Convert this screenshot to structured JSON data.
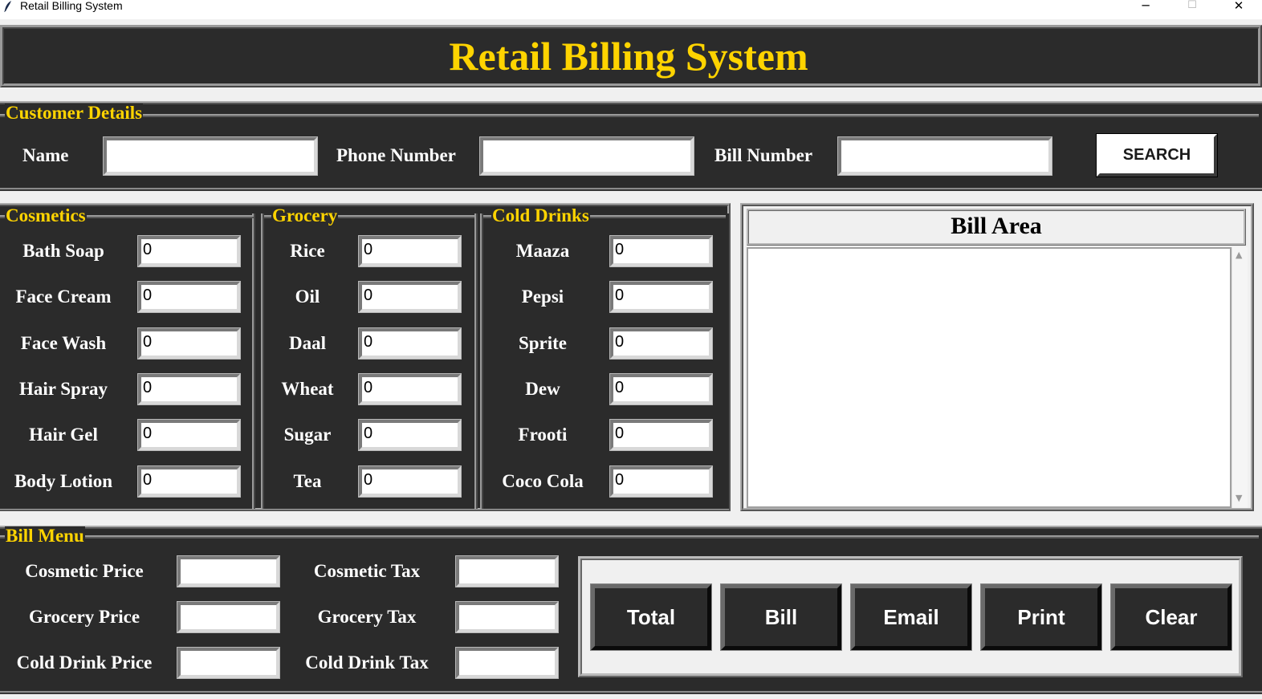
{
  "window": {
    "title": "Retail Billing System",
    "minimize_glyph": "─",
    "maximize_glyph": "☐",
    "close_glyph": "✕"
  },
  "header": {
    "title": "Retail Billing System"
  },
  "customer": {
    "legend": "Customer Details",
    "name_label": "Name",
    "name_value": "",
    "phone_label": "Phone Number",
    "phone_value": "",
    "bill_number_label": "Bill Number",
    "bill_number_value": "",
    "search_button": "SEARCH"
  },
  "cosmetics": {
    "legend": "Cosmetics",
    "items": [
      {
        "label": "Bath Soap",
        "value": "0"
      },
      {
        "label": "Face Cream",
        "value": "0"
      },
      {
        "label": "Face Wash",
        "value": "0"
      },
      {
        "label": "Hair Spray",
        "value": "0"
      },
      {
        "label": "Hair Gel",
        "value": "0"
      },
      {
        "label": "Body Lotion",
        "value": "0"
      }
    ]
  },
  "grocery": {
    "legend": "Grocery",
    "items": [
      {
        "label": "Rice",
        "value": "0"
      },
      {
        "label": "Oil",
        "value": "0"
      },
      {
        "label": "Daal",
        "value": "0"
      },
      {
        "label": "Wheat",
        "value": "0"
      },
      {
        "label": "Sugar",
        "value": "0"
      },
      {
        "label": "Tea",
        "value": "0"
      }
    ]
  },
  "cold_drinks": {
    "legend": "Cold Drinks",
    "items": [
      {
        "label": "Maaza",
        "value": "0"
      },
      {
        "label": "Pepsi",
        "value": "0"
      },
      {
        "label": "Sprite",
        "value": "0"
      },
      {
        "label": "Dew",
        "value": "0"
      },
      {
        "label": "Frooti",
        "value": "0"
      },
      {
        "label": "Coco Cola",
        "value": "0"
      }
    ]
  },
  "bill_area": {
    "title": "Bill Area",
    "text": ""
  },
  "bill_menu": {
    "legend": "Bill Menu",
    "cosmetic_price_label": "Cosmetic Price",
    "cosmetic_price_value": "",
    "grocery_price_label": "Grocery Price",
    "grocery_price_value": "",
    "cold_drink_price_label": "Cold Drink Price",
    "cold_drink_price_value": "",
    "cosmetic_tax_label": "Cosmetic Tax",
    "cosmetic_tax_value": "",
    "grocery_tax_label": "Grocery Tax",
    "grocery_tax_value": "",
    "cold_drink_tax_label": "Cold Drink Tax",
    "cold_drink_tax_value": "",
    "buttons": [
      "Total",
      "Bill",
      "Email",
      "Print",
      "Clear"
    ]
  },
  "colors": {
    "panel_bg": "#2b2b2b",
    "accent_yellow": "#ffd400",
    "label_white": "#ffffff"
  }
}
